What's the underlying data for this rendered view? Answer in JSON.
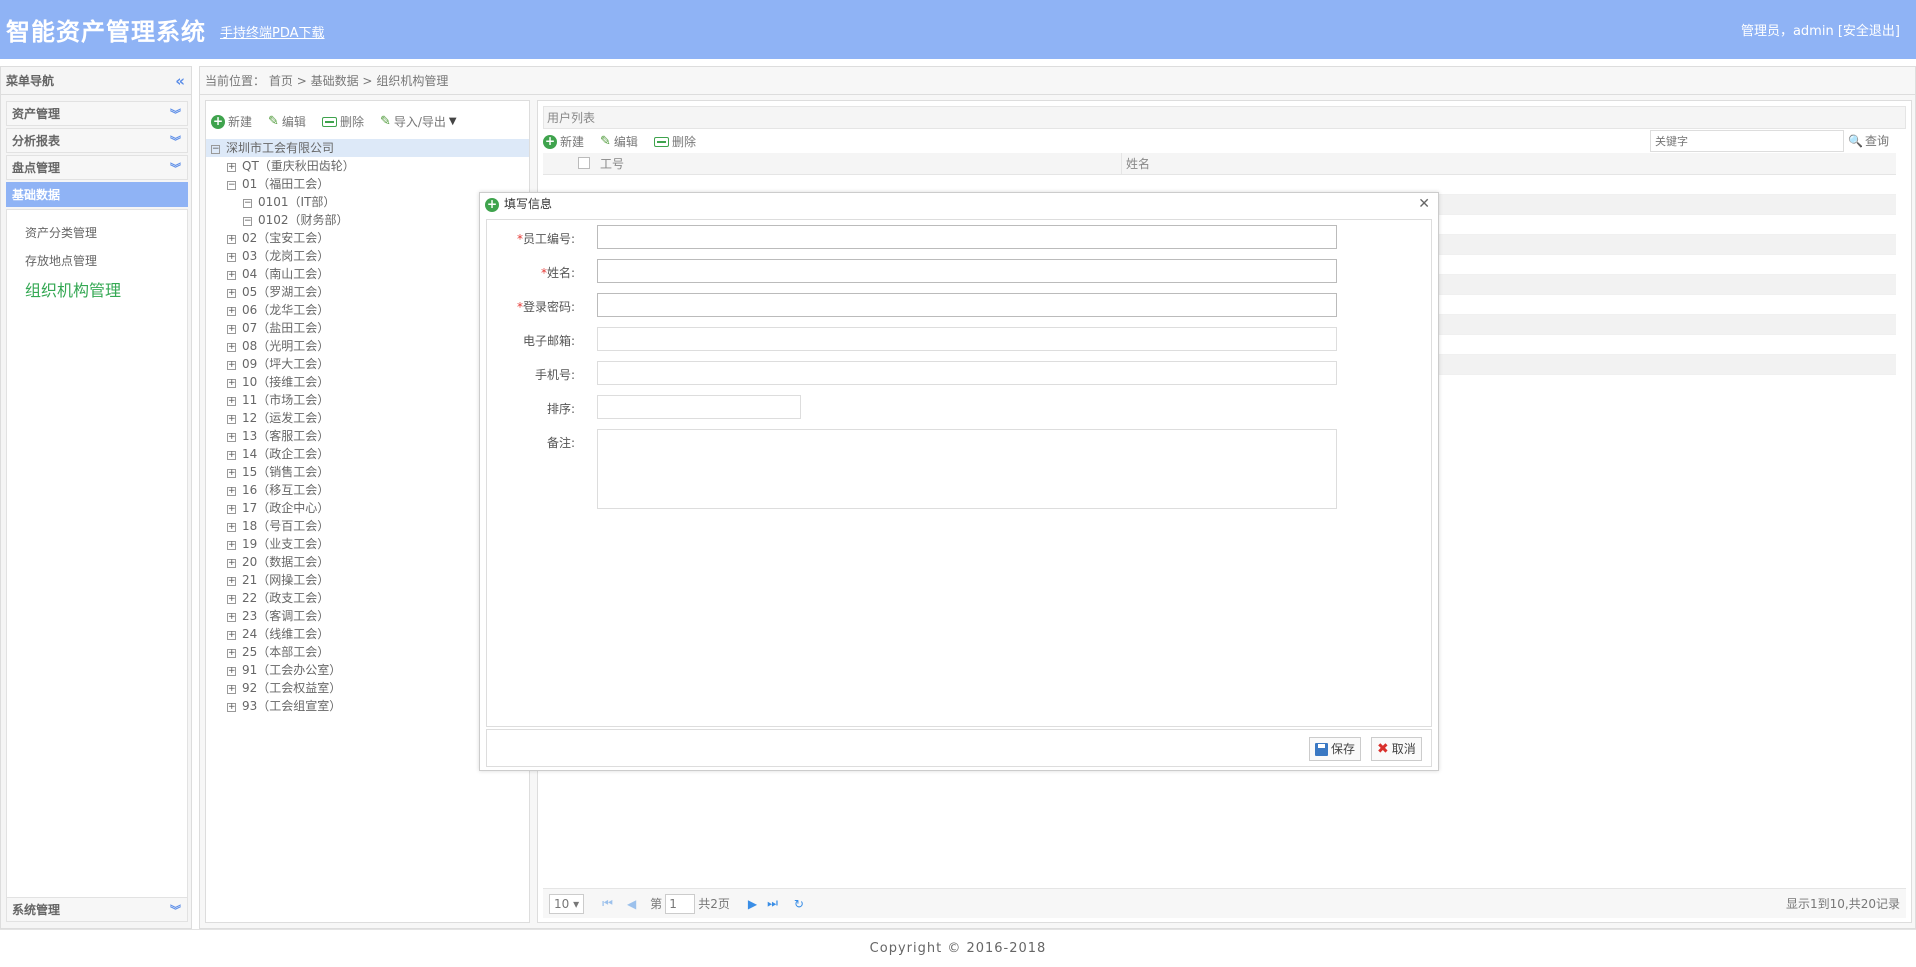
{
  "header": {
    "title": "智能资产管理系统",
    "pda_link": "手持终端PDA下载",
    "user_text": "管理员，admin ",
    "logout_text": "[安全退出]"
  },
  "sidebar": {
    "title": "菜单导航",
    "sections": [
      {
        "label": "资产管理"
      },
      {
        "label": "分析报表"
      },
      {
        "label": "盘点管理"
      },
      {
        "label": "基础数据"
      }
    ],
    "sub_items": [
      {
        "label": "资产分类管理"
      },
      {
        "label": "存放地点管理"
      },
      {
        "label": "组织机构管理"
      }
    ],
    "bottom_section": "系统管理"
  },
  "breadcrumb": {
    "prefix": "当前位置：",
    "path": [
      "首页",
      "基础数据",
      "组织机构管理"
    ],
    "separator": ">"
  },
  "tree_toolbar": {
    "new": "新建",
    "edit": "编辑",
    "delete": "删除",
    "import_export": "导入/导出"
  },
  "tree": [
    {
      "label": "深圳市工会有限公司",
      "level": 0,
      "expanded": true,
      "selected": true
    },
    {
      "label": "QT（重庆秋田齿轮）",
      "level": 1,
      "expanded": false
    },
    {
      "label": "01（福田工会）",
      "level": 1,
      "expanded": true
    },
    {
      "label": "0101（IT部）",
      "level": 2,
      "expanded": true
    },
    {
      "label": "0102（财务部）",
      "level": 2,
      "expanded": true
    },
    {
      "label": "02（宝安工会）",
      "level": 1,
      "expanded": false
    },
    {
      "label": "03（龙岗工会）",
      "level": 1,
      "expanded": false
    },
    {
      "label": "04（南山工会）",
      "level": 1,
      "expanded": false
    },
    {
      "label": "05（罗湖工会）",
      "level": 1,
      "expanded": false
    },
    {
      "label": "06（龙华工会）",
      "level": 1,
      "expanded": false
    },
    {
      "label": "07（盐田工会）",
      "level": 1,
      "expanded": false
    },
    {
      "label": "08（光明工会）",
      "level": 1,
      "expanded": false
    },
    {
      "label": "09（坪大工会）",
      "level": 1,
      "expanded": false
    },
    {
      "label": "10（接维工会）",
      "level": 1,
      "expanded": false
    },
    {
      "label": "11（市场工会）",
      "level": 1,
      "expanded": false
    },
    {
      "label": "12（运发工会）",
      "level": 1,
      "expanded": false
    },
    {
      "label": "13（客服工会）",
      "level": 1,
      "expanded": false
    },
    {
      "label": "14（政企工会）",
      "level": 1,
      "expanded": false
    },
    {
      "label": "15（销售工会）",
      "level": 1,
      "expanded": false
    },
    {
      "label": "16（移互工会）",
      "level": 1,
      "expanded": false
    },
    {
      "label": "17（政企中心）",
      "level": 1,
      "expanded": false
    },
    {
      "label": "18（号百工会）",
      "level": 1,
      "expanded": false
    },
    {
      "label": "19（业支工会）",
      "level": 1,
      "expanded": false
    },
    {
      "label": "20（数据工会）",
      "level": 1,
      "expanded": false
    },
    {
      "label": "21（网操工会）",
      "level": 1,
      "expanded": false
    },
    {
      "label": "22（政支工会）",
      "level": 1,
      "expanded": false
    },
    {
      "label": "23（客调工会）",
      "level": 1,
      "expanded": false
    },
    {
      "label": "24（线维工会）",
      "level": 1,
      "expanded": false
    },
    {
      "label": "25（本部工会）",
      "level": 1,
      "expanded": false
    },
    {
      "label": "91（工会办公室）",
      "level": 1,
      "expanded": false
    },
    {
      "label": "92（工会权益室）",
      "level": 1,
      "expanded": false
    },
    {
      "label": "93（工会组宣室）",
      "level": 1,
      "expanded": false
    }
  ],
  "user_list": {
    "title": "用户列表",
    "toolbar": {
      "new": "新建",
      "edit": "编辑",
      "delete": "删除"
    },
    "search_placeholder": "关键字",
    "search_button": "查询",
    "columns": [
      "工号",
      "姓名"
    ],
    "pager": {
      "page_size": "10",
      "page_prefix": "第",
      "current_page": "1",
      "page_suffix": "共2页",
      "summary": "显示1到10,共20记录"
    }
  },
  "dialog": {
    "title": "填写信息",
    "fields": [
      {
        "label": "员工编号:",
        "required": true,
        "value": ""
      },
      {
        "label": "姓名:",
        "required": true,
        "value": ""
      },
      {
        "label": "登录密码:",
        "required": true,
        "value": ""
      },
      {
        "label": "电子邮箱:",
        "required": false,
        "value": ""
      },
      {
        "label": "手机号:",
        "required": false,
        "value": ""
      },
      {
        "label": "排序:",
        "required": false,
        "value": ""
      },
      {
        "label": "备注:",
        "required": false,
        "value": ""
      }
    ],
    "save_label": "保存",
    "cancel_label": "取消"
  },
  "footer": {
    "copyright": "Copyright © 2016-2018"
  },
  "colors": {
    "header_bg": "#8fb3f5",
    "active_menu": "#8fb3f5",
    "active_sub": "#34a853",
    "required_mark": "#e53935"
  }
}
